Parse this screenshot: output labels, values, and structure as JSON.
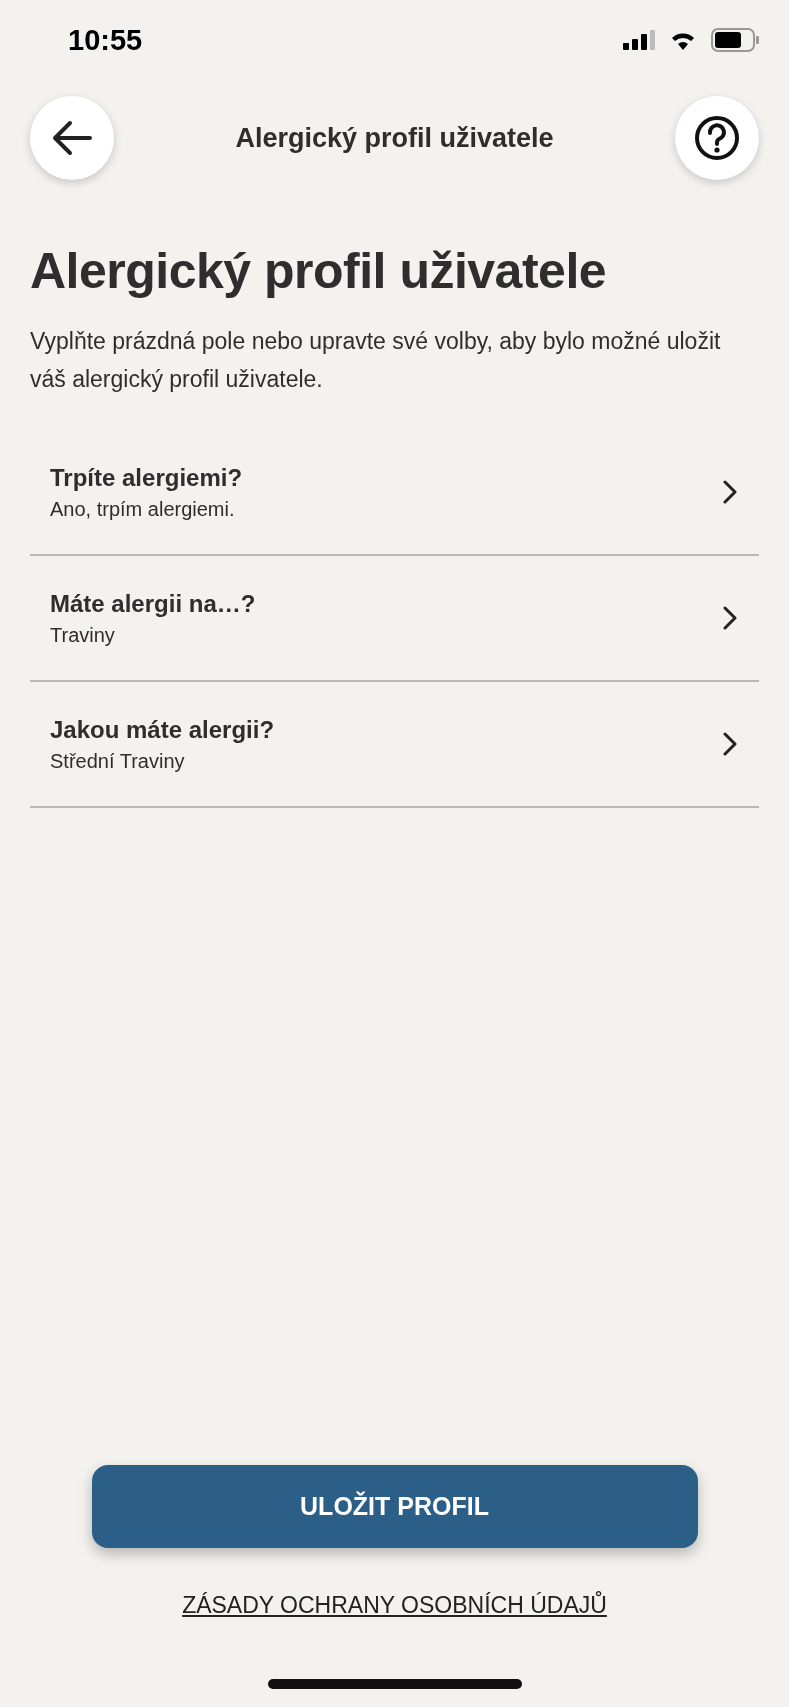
{
  "status_bar": {
    "time": "10:55"
  },
  "header": {
    "title": "Alergický profil uživatele"
  },
  "page": {
    "heading": "Alergický profil uživatele",
    "description": "Vyplňte prázdná pole nebo upravte své volby, aby bylo možné uložit váš alergický profil uživatele."
  },
  "questions": [
    {
      "title": "Trpíte alergiemi?",
      "answer": "Ano, trpím alergiemi."
    },
    {
      "title": "Máte alergii na…?",
      "answer": "Traviny"
    },
    {
      "title": "Jakou máte alergii?",
      "answer": "Střední Traviny"
    }
  ],
  "save_button": "ULOŽIT PROFIL",
  "privacy_link": "ZÁSADY OCHRANY OSOBNÍCH ÚDAJŮ"
}
